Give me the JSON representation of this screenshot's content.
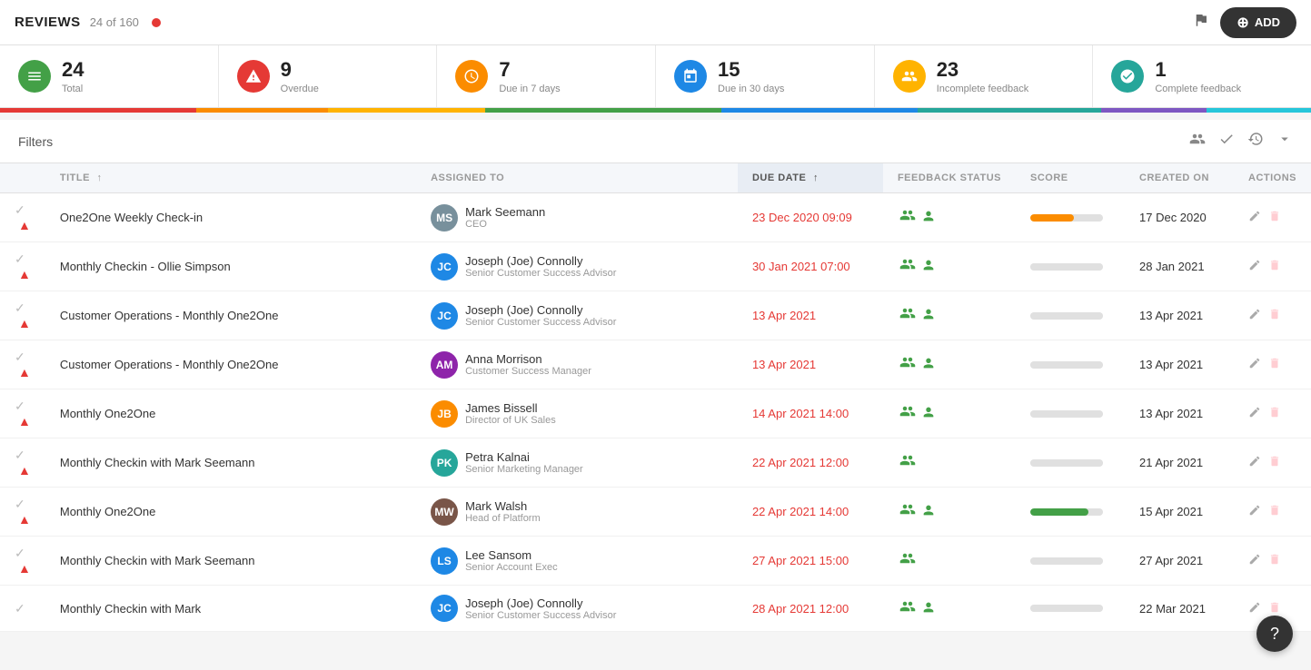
{
  "header": {
    "title": "REVIEWS",
    "count_text": "24 of 160",
    "add_label": "ADD"
  },
  "stats": [
    {
      "id": "total",
      "number": "24",
      "label": "Total",
      "icon_type": "green",
      "icon": "≡"
    },
    {
      "id": "overdue",
      "number": "9",
      "label": "Overdue",
      "icon_type": "red",
      "icon": "⚠"
    },
    {
      "id": "due7",
      "number": "7",
      "label": "Due in 7 days",
      "icon_type": "orange",
      "icon": "◷"
    },
    {
      "id": "due30",
      "number": "15",
      "label": "Due in 30 days",
      "icon_type": "blue",
      "icon": "▭"
    },
    {
      "id": "incomplete",
      "number": "23",
      "label": "Incomplete feedback",
      "icon_type": "amber",
      "icon": "👥"
    },
    {
      "id": "complete",
      "number": "1",
      "label": "Complete feedback",
      "icon_type": "teal",
      "icon": "✓"
    }
  ],
  "progress_segments": [
    {
      "color": "#e53935",
      "width": "15%"
    },
    {
      "color": "#fb8c00",
      "width": "10%"
    },
    {
      "color": "#ffb300",
      "width": "12%"
    },
    {
      "color": "#43a047",
      "width": "18%"
    },
    {
      "color": "#1e88e5",
      "width": "15%"
    },
    {
      "color": "#26a69a",
      "width": "14%"
    },
    {
      "color": "#7e57c2",
      "width": "8%"
    },
    {
      "color": "#26c6da",
      "width": "8%"
    }
  ],
  "filters": {
    "label": "Filters"
  },
  "table": {
    "columns": [
      {
        "id": "check",
        "label": ""
      },
      {
        "id": "title",
        "label": "TITLE"
      },
      {
        "id": "assigned",
        "label": "ASSIGNED TO"
      },
      {
        "id": "due_date",
        "label": "DUE DATE",
        "active": true
      },
      {
        "id": "feedback",
        "label": "FEEDBACK STATUS"
      },
      {
        "id": "score",
        "label": "SCORE"
      },
      {
        "id": "created",
        "label": "CREATED ON"
      },
      {
        "id": "actions",
        "label": "ACTIONS"
      }
    ],
    "rows": [
      {
        "id": 1,
        "title": "One2One Weekly Check-in",
        "overdue": true,
        "assigned_name": "Mark Seemann",
        "assigned_role": "CEO",
        "avatar_initials": "MS",
        "avatar_color": "av-gray",
        "due_date": "23 Dec 2020 09:09",
        "due_date_red": true,
        "feedback_group": true,
        "feedback_single": true,
        "score_pct": 60,
        "score_color": "score-orange",
        "created_on": "17 Dec 2020"
      },
      {
        "id": 2,
        "title": "Monthly Checkin - Ollie Simpson",
        "overdue": true,
        "assigned_name": "Joseph (Joe) Connolly",
        "assigned_role": "Senior Customer Success Advisor",
        "avatar_initials": "JC",
        "avatar_color": "av-blue",
        "due_date": "30 Jan 2021 07:00",
        "due_date_red": true,
        "feedback_group": true,
        "feedback_single": true,
        "score_pct": 0,
        "score_color": "score-empty",
        "created_on": "28 Jan 2021"
      },
      {
        "id": 3,
        "title": "Customer Operations - Monthly One2One",
        "overdue": true,
        "assigned_name": "Joseph (Joe) Connolly",
        "assigned_role": "Senior Customer Success Advisor",
        "avatar_initials": "JC",
        "avatar_color": "av-blue",
        "due_date": "13 Apr 2021",
        "due_date_red": true,
        "feedback_group": true,
        "feedback_single": true,
        "score_pct": 0,
        "score_color": "score-empty",
        "created_on": "13 Apr 2021"
      },
      {
        "id": 4,
        "title": "Customer Operations - Monthly One2One",
        "overdue": true,
        "assigned_name": "Anna Morrison",
        "assigned_role": "Customer Success Manager",
        "avatar_initials": "AM",
        "avatar_color": "av-purple",
        "due_date": "13 Apr 2021",
        "due_date_red": true,
        "feedback_group": true,
        "feedback_single": true,
        "score_pct": 0,
        "score_color": "score-empty",
        "created_on": "13 Apr 2021"
      },
      {
        "id": 5,
        "title": "Monthly One2One",
        "overdue": true,
        "assigned_name": "James Bissell",
        "assigned_role": "Director of UK Sales",
        "avatar_initials": "JB",
        "avatar_color": "av-orange",
        "due_date": "14 Apr 2021 14:00",
        "due_date_red": true,
        "feedback_group": true,
        "feedback_single": true,
        "score_pct": 0,
        "score_color": "score-empty",
        "created_on": "13 Apr 2021"
      },
      {
        "id": 6,
        "title": "Monthly Checkin with Mark Seemann",
        "overdue": true,
        "assigned_name": "Petra Kalnai",
        "assigned_role": "Senior Marketing Manager",
        "avatar_initials": "PK",
        "avatar_color": "av-teal",
        "due_date": "22 Apr 2021 12:00",
        "due_date_red": true,
        "feedback_group": true,
        "feedback_single": false,
        "score_pct": 0,
        "score_color": "score-empty",
        "created_on": "21 Apr 2021"
      },
      {
        "id": 7,
        "title": "Monthly One2One",
        "overdue": true,
        "assigned_name": "Mark Walsh",
        "assigned_role": "Head of Platform",
        "avatar_initials": "MW",
        "avatar_color": "av-brown",
        "due_date": "22 Apr 2021 14:00",
        "due_date_red": true,
        "feedback_group": true,
        "feedback_single": true,
        "score_pct": 80,
        "score_color": "score-green",
        "created_on": "15 Apr 2021"
      },
      {
        "id": 8,
        "title": "Monthly Checkin with Mark Seemann",
        "overdue": true,
        "assigned_name": "Lee Sansom",
        "assigned_role": "Senior Account Exec",
        "avatar_initials": "LS",
        "avatar_color": "av-blue",
        "due_date": "27 Apr 2021 15:00",
        "due_date_red": true,
        "feedback_group": true,
        "feedback_single": false,
        "score_pct": 0,
        "score_color": "score-empty",
        "created_on": "27 Apr 2021"
      },
      {
        "id": 9,
        "title": "Monthly Checkin with Mark",
        "overdue": false,
        "assigned_name": "Joseph (Joe) Connolly",
        "assigned_role": "Senior Customer Success Advisor",
        "avatar_initials": "JC",
        "avatar_color": "av-blue",
        "due_date": "28 Apr 2021 12:00",
        "due_date_red": true,
        "feedback_group": true,
        "feedback_single": true,
        "score_pct": 0,
        "score_color": "score-empty",
        "created_on": "22 Mar 2021"
      }
    ]
  }
}
